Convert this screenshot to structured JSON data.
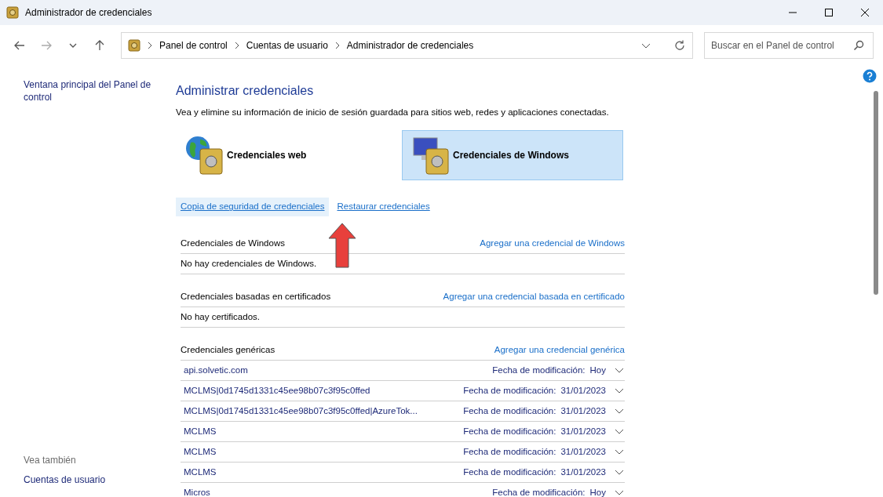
{
  "window": {
    "title": "Administrador de credenciales"
  },
  "address_bar": {
    "breadcrumbs": [
      "Panel de control",
      "Cuentas de usuario",
      "Administrador de credenciales"
    ]
  },
  "search": {
    "placeholder": "Buscar en el Panel de control"
  },
  "sidebar": {
    "items": [
      "Ventana principal del Panel de control"
    ],
    "see_also_heading": "Vea también",
    "see_also": [
      "Cuentas de usuario"
    ]
  },
  "main": {
    "title": "Administrar credenciales",
    "description": "Vea y elimine su información de inicio de sesión guardada para sitios web, redes y aplicaciones conectadas.",
    "tiles": [
      {
        "kind": "web",
        "label": "Credenciales web",
        "selected": false
      },
      {
        "kind": "windows",
        "label": "Credenciales de Windows",
        "selected": true
      }
    ],
    "actions": [
      {
        "label": "Copia de seguridad de credenciales",
        "highlighted": true
      },
      {
        "label": "Restaurar credenciales",
        "highlighted": false
      }
    ],
    "sections": [
      {
        "title": "Credenciales de Windows",
        "add_link": "Agregar una credencial de Windows",
        "empty_text": "No hay credenciales de Windows."
      },
      {
        "title": "Credenciales basadas en certificados",
        "add_link": "Agregar una credencial basada en certificado",
        "empty_text": "No hay certificados."
      },
      {
        "title": "Credenciales genéricas",
        "add_link": "Agregar una credencial genérica",
        "items": [
          {
            "name": "api.solvetic.com",
            "date_label": "Fecha de modificación:",
            "date": "Hoy"
          },
          {
            "name": "MCLMS|0d1745d1331c45ee98b07c3f95c0ffed",
            "date_label": "Fecha de modificación:",
            "date": "31/01/2023"
          },
          {
            "name": "MCLMS|0d1745d1331c45ee98b07c3f95c0ffed|AzureTok...",
            "date_label": "Fecha de modificación:",
            "date": "31/01/2023"
          },
          {
            "name": "MCLMS",
            "date_label": "Fecha de modificación:",
            "date": "31/01/2023"
          },
          {
            "name": "MCLMS",
            "date_label": "Fecha de modificación:",
            "date": "31/01/2023"
          },
          {
            "name": "MCLMS",
            "date_label": "Fecha de modificación:",
            "date": "31/01/2023"
          },
          {
            "name": "Micros",
            "date_label": "Fecha de modificación:",
            "date": "Hoy"
          }
        ]
      }
    ]
  }
}
